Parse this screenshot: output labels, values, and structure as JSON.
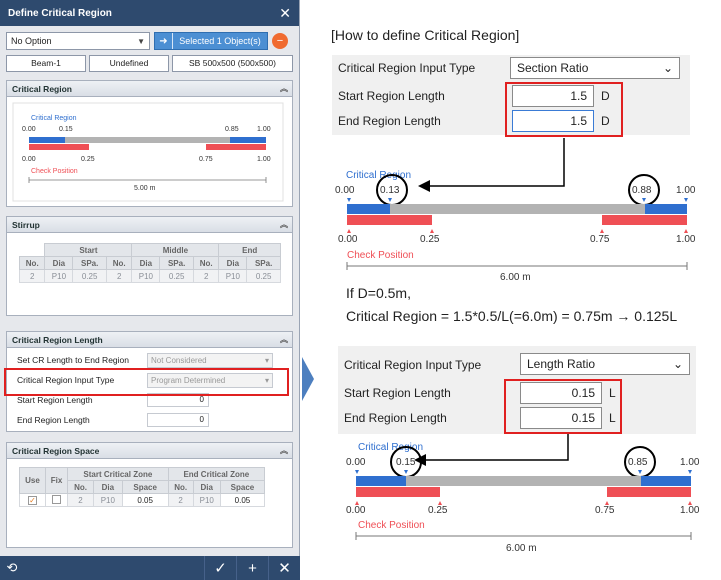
{
  "dialog": {
    "title": "Define Critical Region",
    "option_select": "No Option",
    "selected_label": "Selected 1 Object(s)",
    "info": [
      "Beam-1",
      "Undefined",
      "SB 500x500 (500x500)"
    ]
  },
  "critical_region_section": {
    "title": "Critical Region",
    "cr_label": "Critical Region",
    "cp_label": "Check Position",
    "top_ticks": [
      "0.00",
      "0.15",
      "0.85",
      "1.00"
    ],
    "bottom_ticks": [
      "0.00",
      "0.25",
      "0.75",
      "1.00"
    ],
    "length": "5.00 m"
  },
  "stirrup": {
    "title": "Stirrup",
    "groups": [
      "Start",
      "Middle",
      "End"
    ],
    "cols": [
      "No.",
      "Dia",
      "SPa."
    ],
    "row": [
      "2",
      "P10",
      "0.25",
      "2",
      "P10",
      "0.25",
      "2",
      "P10",
      "0.25"
    ]
  },
  "cr_length": {
    "title": "Critical Region Length",
    "rows": [
      {
        "label": "Set CR Length to End Region",
        "value": "Not Considered"
      },
      {
        "label": "Critical Region Input Type",
        "value": "Program Determined"
      },
      {
        "label": "Start Region Length",
        "value": "0"
      },
      {
        "label": "End Region Length",
        "value": "0"
      }
    ]
  },
  "cr_space": {
    "title": "Critical Region Space",
    "h_use": "Use",
    "h_fix": "Fix",
    "h_start": "Start Critical Zone",
    "h_end": "End Critical Zone",
    "sub": [
      "No.",
      "Dia",
      "Space",
      "No.",
      "Dia",
      "Space"
    ],
    "row": [
      "2",
      "P10",
      "0.05",
      "2",
      "P10",
      "0.05"
    ],
    "use_checked": true,
    "fix_checked": false
  },
  "howto": {
    "title": "[How to define Critical Region]",
    "form1": {
      "type_label": "Critical Region Input Type",
      "type_value": "Section Ratio",
      "start_label": "Start Region Length",
      "start_value": "1.5",
      "start_unit": "D",
      "end_label": "End Region Length",
      "end_value": "1.5",
      "end_unit": "D"
    },
    "diagram1": {
      "cr_label": "Critical Region",
      "cp_label": "Check Position",
      "top_ticks": [
        "0.00",
        "0.13",
        "0.88",
        "1.00"
      ],
      "bottom_ticks": [
        "0.00",
        "0.25",
        "0.75",
        "1.00"
      ],
      "length": "6.00 m"
    },
    "note_line1": "If D=0.5m,",
    "note_line2": "Critical Region = 1.5*0.5/L(=6.0m) = 0.75m → 0.125L",
    "form2": {
      "type_label": "Critical Region Input Type",
      "type_value": "Length Ratio",
      "start_label": "Start Region Length",
      "start_value": "0.15",
      "start_unit": "L",
      "end_label": "End Region Length",
      "end_value": "0.15",
      "end_unit": "L"
    },
    "diagram2": {
      "cr_label": "Critical Region",
      "cp_label": "Check Position",
      "top_ticks": [
        "0.00",
        "0.15",
        "0.85",
        "1.00"
      ],
      "bottom_ticks": [
        "0.00",
        "0.25",
        "0.75",
        "1.00"
      ],
      "length": "6.00 m"
    }
  },
  "colors": {
    "cr_blue": "#2f6fcf",
    "cp_red": "#ef4f55",
    "bar_gray": "#b3b3b3",
    "accent_red_box": "#e02020"
  }
}
